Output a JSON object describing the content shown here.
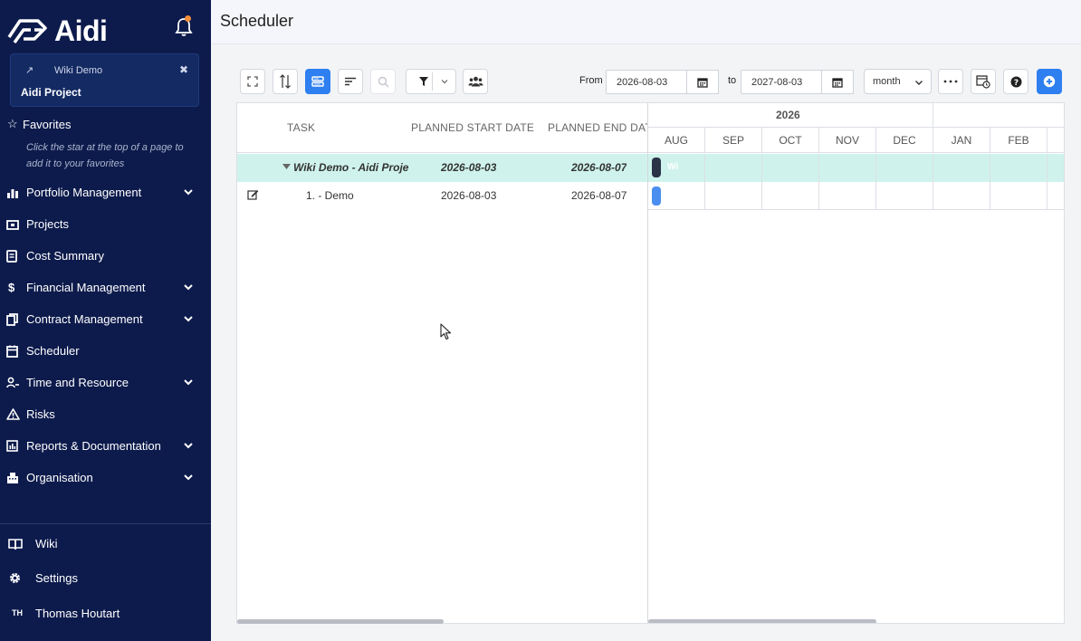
{
  "sidebar": {
    "brand": "Aidi",
    "project_card": {
      "title": "Wiki Demo",
      "name": "Aidi Project"
    },
    "favorites": {
      "label": "Favorites",
      "hint": "Click the star at the top of a page to add it to your favorites"
    },
    "items": [
      {
        "label": "Portfolio Management",
        "icon": "bar-chart-icon",
        "expandable": true
      },
      {
        "label": "Projects",
        "icon": "projects-icon",
        "expandable": false
      },
      {
        "label": "Cost Summary",
        "icon": "document-icon",
        "expandable": false
      },
      {
        "label": "Financial Management",
        "icon": "dollar-icon",
        "expandable": true
      },
      {
        "label": "Contract Management",
        "icon": "copy-icon",
        "expandable": true
      },
      {
        "label": "Scheduler",
        "icon": "calendar-icon",
        "expandable": false
      },
      {
        "label": "Time and Resource",
        "icon": "user-clock-icon",
        "expandable": true
      },
      {
        "label": "Risks",
        "icon": "warning-icon",
        "expandable": false
      },
      {
        "label": "Reports & Documentation",
        "icon": "report-icon",
        "expandable": true
      },
      {
        "label": "Organisation",
        "icon": "building-icon",
        "expandable": true
      }
    ],
    "bottom": {
      "wiki": "Wiki",
      "settings": "Settings",
      "user_initials": "TH",
      "user_name": "Thomas Houtart"
    },
    "colors": {
      "bg": "#0d1b4c",
      "notification": "#f5903a"
    }
  },
  "header": {
    "title": "Scheduler"
  },
  "toolbar": {
    "from_label": "From",
    "from_value": "2026-08-03",
    "to_label": "to",
    "to_value": "2027-08-03",
    "period": "month",
    "accent": "#2e7ff0"
  },
  "grid": {
    "columns": [
      "TASK",
      "PLANNED START DATE",
      "PLANNED END DAT"
    ],
    "rows": [
      {
        "task": "Wiki Demo - Aidi Proje",
        "start": "2026-08-03",
        "end": "2026-08-07",
        "group": true
      },
      {
        "task": "1. - Demo",
        "start": "2026-08-03",
        "end": "2026-08-07",
        "group": false
      }
    ]
  },
  "gantt": {
    "year": "2026",
    "months": [
      "AUG",
      "SEP",
      "OCT",
      "NOV",
      "DEC",
      "JAN",
      "FEB"
    ],
    "bar_label": "Wi",
    "colors": {
      "group_bar": "#2b3346",
      "task_bar": "#4a8ff0",
      "row_highlight": "#cff3ec"
    }
  }
}
